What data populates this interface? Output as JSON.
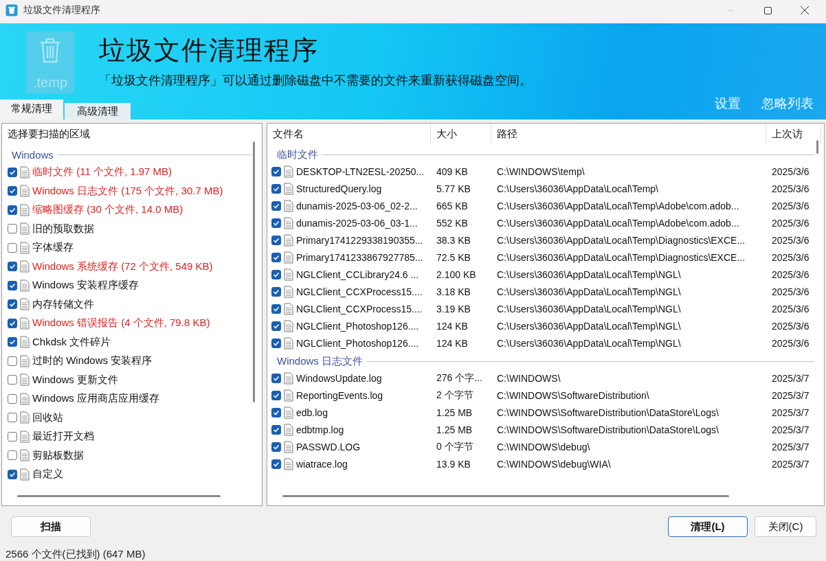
{
  "window": {
    "title": "垃圾文件清理程序"
  },
  "banner": {
    "title": "垃圾文件清理程序",
    "description": "「垃圾文件清理程序」可以通过删除磁盘中不需要的文件来重新获得磁盘空间。",
    "icon_caption": ".temp",
    "links": [
      "设置",
      "忽略列表"
    ]
  },
  "tabs": [
    {
      "label": "常规清理",
      "selected": true
    },
    {
      "label": "高级清理",
      "selected": false
    }
  ],
  "areas": {
    "heading": "选择要扫描的区域",
    "group": "Windows",
    "items": [
      {
        "label": "临时文件 (11 个文件, 1.97 MB)",
        "checked": true,
        "found": true
      },
      {
        "label": "Windows 日志文件 (175 个文件, 30.7 MB)",
        "checked": true,
        "found": true
      },
      {
        "label": "缩略图缓存 (30 个文件, 14.0 MB)",
        "checked": true,
        "found": true
      },
      {
        "label": "旧的预取数据",
        "checked": false,
        "found": false
      },
      {
        "label": "字体缓存",
        "checked": false,
        "found": false
      },
      {
        "label": "Windows 系统缓存 (72 个文件, 549 KB)",
        "checked": true,
        "found": true
      },
      {
        "label": "Windows 安装程序缓存",
        "checked": true,
        "found": false
      },
      {
        "label": "内存转储文件",
        "checked": true,
        "found": false
      },
      {
        "label": "Windows 错误报告 (4 个文件, 79.8 KB)",
        "checked": true,
        "found": true
      },
      {
        "label": "Chkdsk 文件碎片",
        "checked": true,
        "found": false
      },
      {
        "label": "过时的 Windows 安装程序",
        "checked": false,
        "found": false
      },
      {
        "label": "Windows 更新文件",
        "checked": false,
        "found": false
      },
      {
        "label": "Windows 应用商店应用缓存",
        "checked": false,
        "found": false
      },
      {
        "label": "回收站",
        "checked": false,
        "found": false
      },
      {
        "label": "最近打开文档",
        "checked": false,
        "found": false
      },
      {
        "label": "剪贴板数据",
        "checked": false,
        "found": false
      },
      {
        "label": "自定义",
        "checked": true,
        "found": false
      }
    ]
  },
  "files": {
    "columns": [
      "文件名",
      "大小",
      "路径",
      "上次访"
    ],
    "groups": [
      {
        "name": "临时文件",
        "rows": [
          {
            "name": "DESKTOP-LTN2ESL-20250...",
            "size": "409 KB",
            "path": "C:\\WINDOWS\\temp\\",
            "accessed": "2025/3/6",
            "checked": true
          },
          {
            "name": "StructuredQuery.log",
            "size": "5.77 KB",
            "path": "C:\\Users\\36036\\AppData\\Local\\Temp\\",
            "accessed": "2025/3/6",
            "checked": true
          },
          {
            "name": "dunamis-2025-03-06_02-2...",
            "size": "665 KB",
            "path": "C:\\Users\\36036\\AppData\\Local\\Temp\\Adobe\\com.adob...",
            "accessed": "2025/3/6",
            "checked": true
          },
          {
            "name": "dunamis-2025-03-06_03-1...",
            "size": "552 KB",
            "path": "C:\\Users\\36036\\AppData\\Local\\Temp\\Adobe\\com.adob...",
            "accessed": "2025/3/6",
            "checked": true
          },
          {
            "name": "Primary1741229338190355...",
            "size": "38.3 KB",
            "path": "C:\\Users\\36036\\AppData\\Local\\Temp\\Diagnostics\\EXCE...",
            "accessed": "2025/3/6",
            "checked": true
          },
          {
            "name": "Primary1741233867927785...",
            "size": "72.5 KB",
            "path": "C:\\Users\\36036\\AppData\\Local\\Temp\\Diagnostics\\EXCE...",
            "accessed": "2025/3/6",
            "checked": true
          },
          {
            "name": "NGLClient_CCLibrary24.6 ...",
            "size": "2.100 KB",
            "path": "C:\\Users\\36036\\AppData\\Local\\Temp\\NGL\\",
            "accessed": "2025/3/6",
            "checked": true
          },
          {
            "name": "NGLClient_CCXProcess15....",
            "size": "3.18 KB",
            "path": "C:\\Users\\36036\\AppData\\Local\\Temp\\NGL\\",
            "accessed": "2025/3/6",
            "checked": true
          },
          {
            "name": "NGLClient_CCXProcess15....",
            "size": "3.19 KB",
            "path": "C:\\Users\\36036\\AppData\\Local\\Temp\\NGL\\",
            "accessed": "2025/3/6",
            "checked": true
          },
          {
            "name": "NGLClient_Photoshop126....",
            "size": "124 KB",
            "path": "C:\\Users\\36036\\AppData\\Local\\Temp\\NGL\\",
            "accessed": "2025/3/6",
            "checked": true
          },
          {
            "name": "NGLClient_Photoshop126....",
            "size": "124 KB",
            "path": "C:\\Users\\36036\\AppData\\Local\\Temp\\NGL\\",
            "accessed": "2025/3/6",
            "checked": true
          }
        ]
      },
      {
        "name": "Windows 日志文件",
        "rows": [
          {
            "name": "WindowsUpdate.log",
            "size": "276 个字...",
            "path": "C:\\WINDOWS\\",
            "accessed": "2025/3/7",
            "checked": true
          },
          {
            "name": "ReportingEvents.log",
            "size": "2 个字节",
            "path": "C:\\WINDOWS\\SoftwareDistribution\\",
            "accessed": "2025/3/7",
            "checked": true
          },
          {
            "name": "edb.log",
            "size": "1.25 MB",
            "path": "C:\\WINDOWS\\SoftwareDistribution\\DataStore\\Logs\\",
            "accessed": "2025/3/7",
            "checked": true
          },
          {
            "name": "edbtmp.log",
            "size": "1.25 MB",
            "path": "C:\\WINDOWS\\SoftwareDistribution\\DataStore\\Logs\\",
            "accessed": "2025/3/7",
            "checked": true
          },
          {
            "name": "PASSWD.LOG",
            "size": "0 个字节",
            "path": "C:\\WINDOWS\\debug\\",
            "accessed": "2025/3/7",
            "checked": true
          },
          {
            "name": "wiatrace.log",
            "size": "13.9 KB",
            "path": "C:\\WINDOWS\\debug\\WIA\\",
            "accessed": "2025/3/7",
            "checked": true
          }
        ]
      }
    ]
  },
  "buttons": {
    "scan": "扫描",
    "clean": "清理(L)",
    "close": "关闭(C)"
  },
  "status_bar": "2566 个文件(已找到) (647 MB)"
}
